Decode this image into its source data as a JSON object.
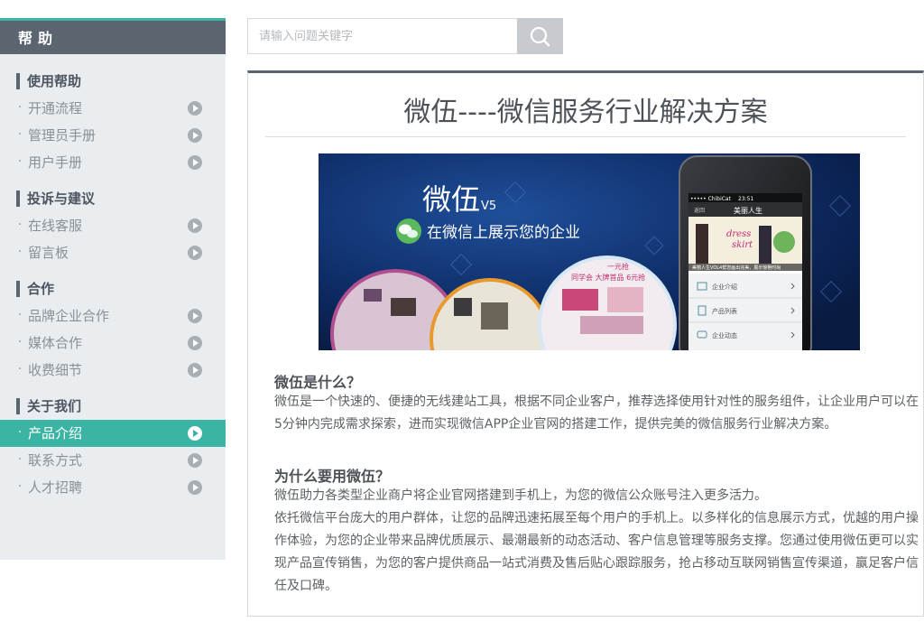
{
  "sidebar": {
    "header": "帮助",
    "groups": [
      {
        "title": "使用帮助",
        "items": [
          "开通流程",
          "管理员手册",
          "用户手册"
        ]
      },
      {
        "title": "投诉与建议",
        "items": [
          "在线客服",
          "留言板"
        ]
      },
      {
        "title": "合作",
        "items": [
          "品牌企业合作",
          "媒体合作",
          "收费细节"
        ]
      },
      {
        "title": "关于我们",
        "items": [
          "产品介绍",
          "联系方式",
          "人才招聘"
        ]
      }
    ],
    "active_item": "产品介绍",
    "bullet": "·"
  },
  "search": {
    "placeholder": "请输入问题关键字",
    "icon": "search-icon"
  },
  "content": {
    "title": "微伍----微信服务行业解决方案",
    "banner": {
      "brand": "微伍",
      "version": "V5",
      "slogan": "在微信上展示您的企业",
      "phone_status_left": "••••• ChibiCat",
      "phone_time": "23:51",
      "phone_back": "返回",
      "phone_title": "美丽人生",
      "phone_ad_text1": "dress",
      "phone_ad_text2": "skirt",
      "phone_caption": "美丽人生VOL4帮您画出完美，展示惊艳时尚",
      "phone_menu": [
        "企业介绍",
        "产品列表",
        "企业动态"
      ],
      "circle_text1": "同学会 大牌首品 6元抢",
      "circle_text2": "一元抢"
    },
    "sections": [
      {
        "heading": "微伍是什么？",
        "paragraphs": [
          "微伍是一个快速的、便捷的无线建站工具，根据不同企业客户，推荐选择使用针对性的服务组件，让企业用户可以在5分钟内完成需求探索，进而实现微信APP企业官网的搭建工作，提供完美的微信服务行业解决方案。"
        ]
      },
      {
        "heading": "为什么要用微伍？",
        "paragraphs": [
          "微伍助力各类型企业商户将企业官网搭建到手机上，为您的微信公众账号注入更多活力。",
          "依托微信平台庞大的用户群体，让您的品牌迅速拓展至每个用户的手机上。以多样化的信息展示方式，优越的用户操作体验，为您的企业带来品牌优质展示、最潮最新的动态活动、客户信息管理等服务支撑。您通过使用微伍更可以实现产品宣传销售，为您的客户提供商品一站式消费及售后贴心跟踪服务，抢占移动互联网销售宣传渠道，赢足客户信任及口碑。"
        ]
      }
    ]
  },
  "colors": {
    "accent": "#3cb4a4",
    "sidebar_header": "#5a6570",
    "sidebar_bg": "#e9edf0"
  }
}
